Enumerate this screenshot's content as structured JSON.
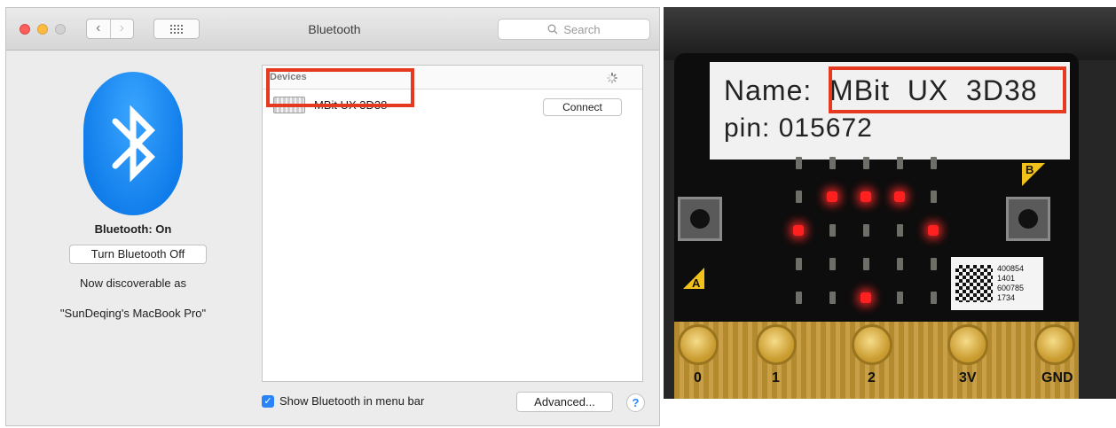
{
  "window": {
    "title": "Bluetooth",
    "search_placeholder": "Search",
    "nav_back": "‹",
    "nav_forward": "›"
  },
  "bluetooth": {
    "status": "Bluetooth: On",
    "toggle_label": "Turn Bluetooth Off",
    "discoverable_line1": "Now discoverable as",
    "discoverable_line2": "\"SunDeqing's MacBook Pro\""
  },
  "devices": {
    "header": "Devices",
    "items": [
      {
        "name": "MBit UX 3D38",
        "action": "Connect"
      }
    ]
  },
  "footer": {
    "show_in_menu_bar_label": "Show Bluetooth in menu bar",
    "show_in_menu_bar_checked": true,
    "advanced_label": "Advanced...",
    "help_label": "?"
  },
  "photo": {
    "label_name": "Name:  MBit  UX  3D38",
    "label_pin": "pin:  015672",
    "button_a": "A",
    "button_b": "B",
    "qr_text": "400854\n1401\n600785\n1734",
    "pins": [
      "0",
      "1",
      "2",
      "3V",
      "GND"
    ],
    "led_matrix": [
      [
        0,
        0,
        0,
        0,
        0
      ],
      [
        0,
        1,
        1,
        1,
        0
      ],
      [
        1,
        0,
        0,
        0,
        1
      ],
      [
        0,
        0,
        0,
        0,
        0
      ],
      [
        0,
        0,
        1,
        0,
        0
      ]
    ]
  },
  "colors": {
    "highlight": "#e53a20",
    "bluetooth_blue": "#0f7cea",
    "checkbox_blue": "#2a84f7"
  }
}
